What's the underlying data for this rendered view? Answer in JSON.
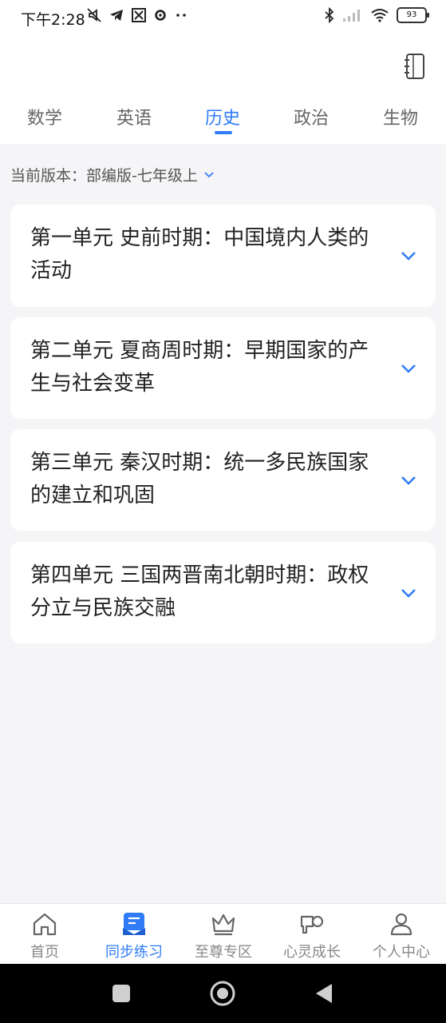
{
  "status_bar": {
    "time": "下午2:28",
    "battery": "93"
  },
  "header": {
    "tabs": [
      {
        "label": "数学"
      },
      {
        "label": "英语"
      },
      {
        "label": "历史",
        "active": true
      },
      {
        "label": "政治"
      },
      {
        "label": "生物"
      }
    ]
  },
  "version": {
    "label": "当前版本：部编版-七年级上"
  },
  "units": [
    {
      "title": "第一单元 史前时期：中国境内人类的活动"
    },
    {
      "title": "第二单元 夏商周时期：早期国家的产生与社会变革"
    },
    {
      "title": "第三单元 秦汉时期：统一多民族国家的建立和巩固"
    },
    {
      "title": "第四单元 三国两晋南北朝时期：政权分立与民族交融"
    }
  ],
  "bottom_nav": [
    {
      "label": "首页",
      "icon": "home-icon"
    },
    {
      "label": "同步练习",
      "icon": "practice-icon",
      "active": true
    },
    {
      "label": "至尊专区",
      "icon": "crown-icon"
    },
    {
      "label": "心灵成长",
      "icon": "growth-icon"
    },
    {
      "label": "个人中心",
      "icon": "person-icon"
    }
  ],
  "colors": {
    "accent": "#2f7cf6",
    "background": "#f5f5f7",
    "card": "#ffffff",
    "text": "#222222",
    "muted": "#888888"
  }
}
